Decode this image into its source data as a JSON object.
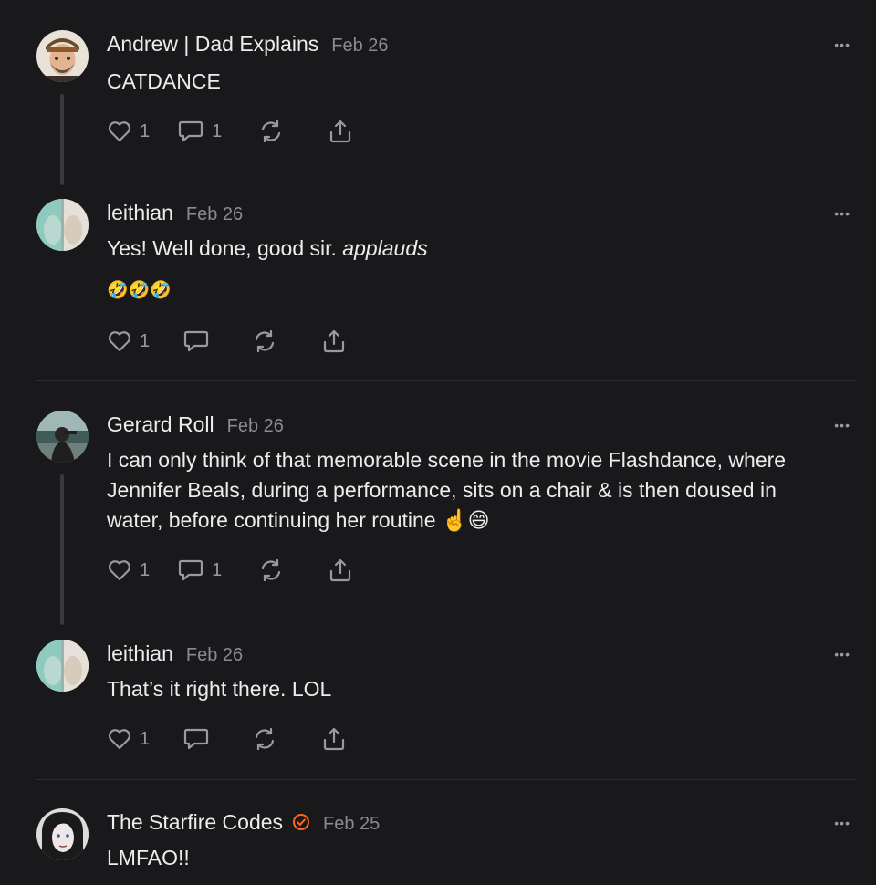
{
  "comments": [
    {
      "author": "Andrew | Dad Explains",
      "date": "Feb 26",
      "body": "CATDANCE",
      "likes": "1",
      "replies": "1"
    },
    {
      "author": "leithian",
      "date": "Feb 26",
      "body_prefix": "Yes! Well done, good sir. ",
      "body_italic": "applauds",
      "emoji": "🤣🤣🤣",
      "likes": "1"
    },
    {
      "author": "Gerard Roll",
      "date": "Feb 26",
      "body": "I can only think of that memorable scene in the movie Flashdance, where Jennifer Beals, during a performance, sits on a chair & is then doused in water, before continuing her routine ☝️😄",
      "likes": "1",
      "replies": "1"
    },
    {
      "author": "leithian",
      "date": "Feb 26",
      "body": "That’s it right there. LOL",
      "likes": "1"
    },
    {
      "author": "The Starfire Codes",
      "date": "Feb 25",
      "body": "LMFAO!!"
    }
  ],
  "more_label": "•••",
  "icons": {
    "like": "heart-icon",
    "reply": "comment-bubble-icon",
    "restack": "restack-icon",
    "share": "share-icon",
    "more": "more-options-icon",
    "verified": "verified-check-icon"
  },
  "colors": {
    "background": "#19191b",
    "text": "#ececec",
    "muted": "#8b8b8f",
    "verified": "#ff6719"
  }
}
